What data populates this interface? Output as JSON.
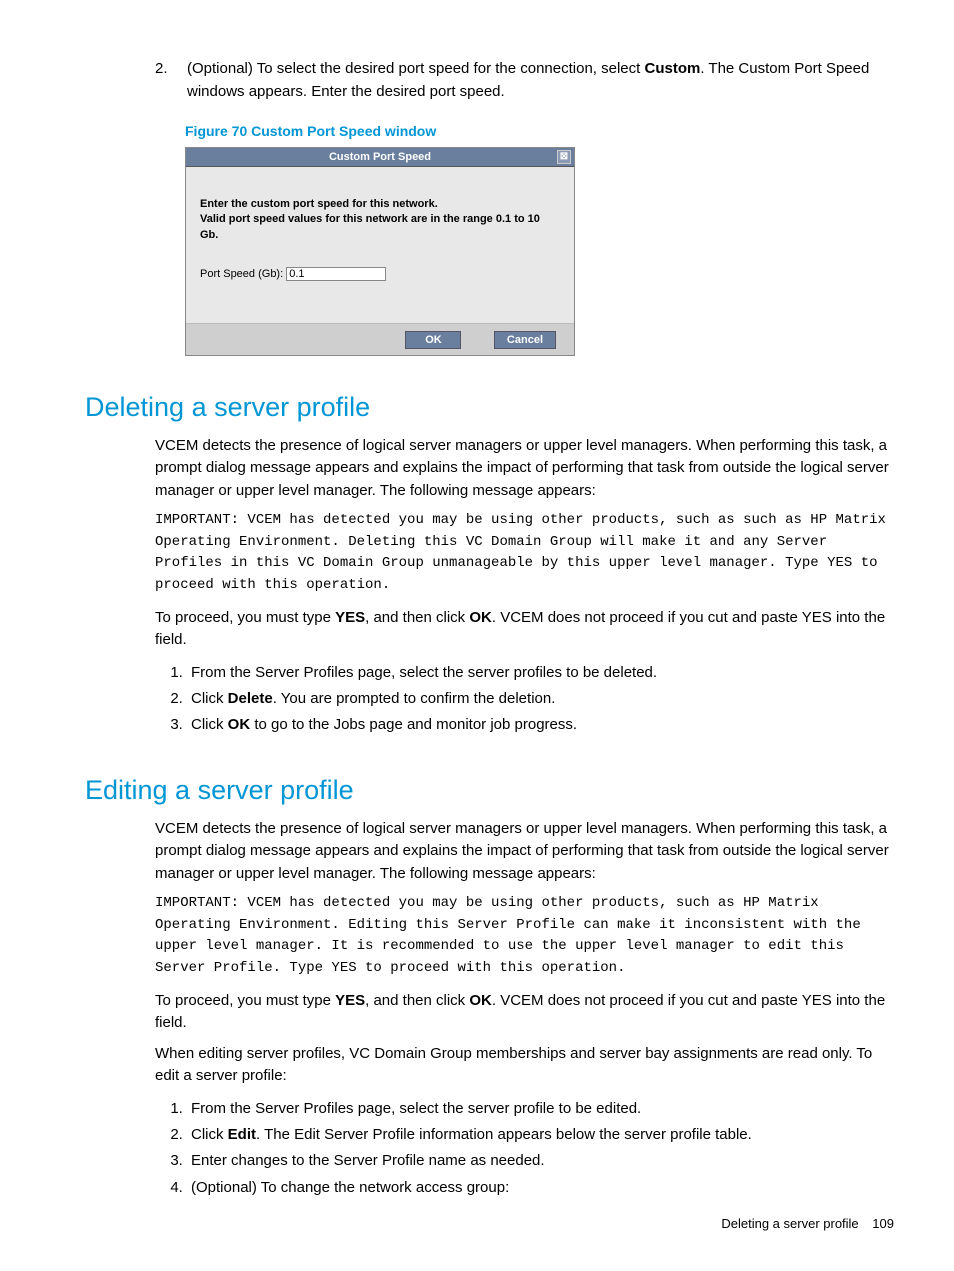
{
  "intro_step": {
    "num": "2.",
    "text_before": "(Optional) To select the desired port speed for the connection, select ",
    "bold": "Custom",
    "text_after": ". The Custom Port Speed windows appears. Enter the desired port speed."
  },
  "figure_caption": "Figure 70 Custom Port Speed window",
  "dialog": {
    "title": "Custom Port Speed",
    "close_icon": "⊠",
    "line1": "Enter the custom port speed for this network.",
    "line2": "Valid port speed values for this network are in the range 0.1 to 10 Gb.",
    "input_label": "Port Speed (Gb):",
    "input_value": "0.1",
    "ok": "OK",
    "cancel": "Cancel"
  },
  "section1": {
    "heading": "Deleting a server profile",
    "para1": "VCEM detects the presence of logical server managers or upper level managers. When performing this task, a prompt dialog message appears and explains the impact of performing that task from outside the logical server manager or upper level manager. The following message appears:",
    "important": "IMPORTANT: VCEM has detected you may be using other products, such as such as HP Matrix Operating Environment. Deleting this VC Domain Group will make it and any Server Profiles in this VC Domain Group unmanageable by this upper level manager. Type YES to proceed with this operation.",
    "para2_a": "To proceed, you must type ",
    "para2_yes": "YES",
    "para2_b": ", and then click ",
    "para2_ok": "OK",
    "para2_c": ". VCEM does not proceed if you cut and paste YES into the field.",
    "steps": [
      {
        "text": "From the Server Profiles page, select the server profiles to be deleted."
      },
      {
        "a": "Click ",
        "bold": "Delete",
        "b": ". You are prompted to confirm the deletion."
      },
      {
        "a": "Click ",
        "bold": "OK",
        "b": " to go to the Jobs page and monitor job progress."
      }
    ]
  },
  "section2": {
    "heading": "Editing a server profile",
    "para1": "VCEM detects the presence of logical server managers or upper level managers. When performing this task, a prompt dialog message appears and explains the impact of performing that task from outside the logical server manager or upper level manager. The following message appears:",
    "important": "IMPORTANT: VCEM has detected you may be using other products, such as HP Matrix Operating Environment. Editing this Server Profile can make it inconsistent with the upper level manager. It is recommended to use the upper level manager to edit this Server Profile. Type YES to proceed with this operation.",
    "para2_a": "To proceed, you must type ",
    "para2_yes": "YES",
    "para2_b": ", and then click ",
    "para2_ok": "OK",
    "para2_c": ". VCEM does not proceed if you cut and paste YES into the field.",
    "para3": "When editing server profiles, VC Domain Group memberships and server bay assignments are read only. To edit a server profile:",
    "steps": [
      {
        "text": "From the Server Profiles page, select the server profile to be edited."
      },
      {
        "a": "Click ",
        "bold": "Edit",
        "b": ". The Edit Server Profile information appears below the server profile table."
      },
      {
        "text": "Enter changes to the Server Profile name as needed."
      },
      {
        "text": "(Optional) To change the network access group:"
      }
    ]
  },
  "footer": {
    "text": "Deleting a server profile",
    "page": "109"
  }
}
